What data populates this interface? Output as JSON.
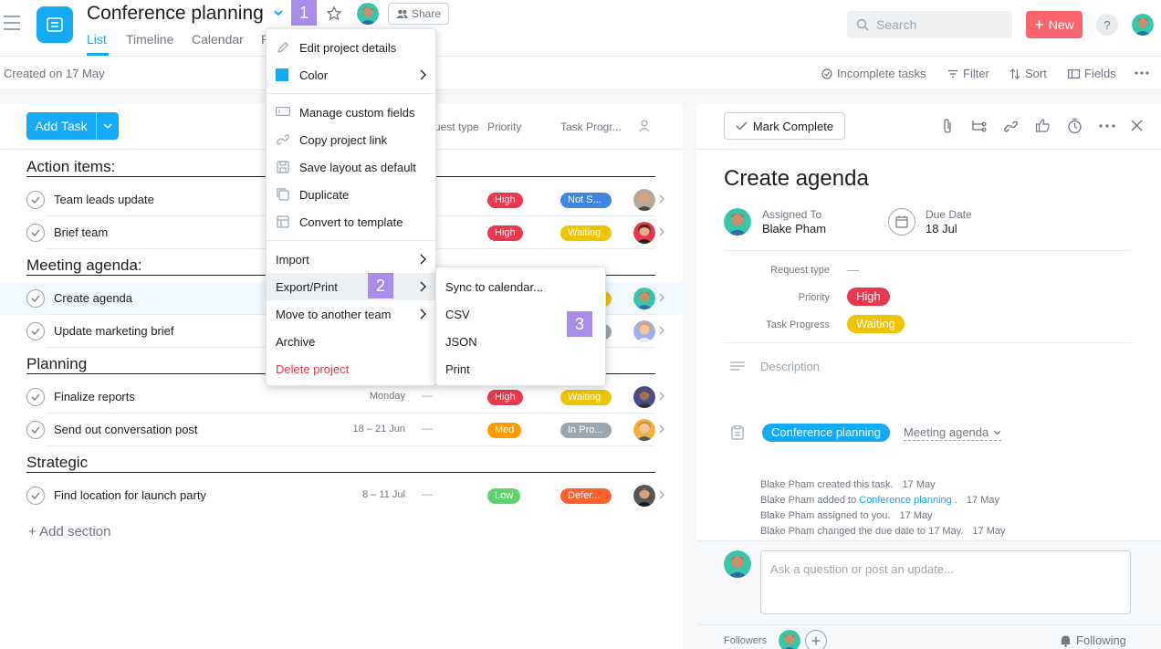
{
  "project": {
    "title": "Conference planning",
    "tabs": [
      "List",
      "Timeline",
      "Calendar",
      "P"
    ],
    "share_label": "Share",
    "created": "Created on 17 May"
  },
  "callouts": [
    "1",
    "2",
    "3"
  ],
  "topbar": {
    "search_placeholder": "Search",
    "new_label": "New",
    "help_label": "?"
  },
  "toolbar": {
    "incomplete": "Incomplete tasks",
    "filter": "Filter",
    "sort": "Sort",
    "fields": "Fields"
  },
  "list": {
    "add_task": "Add Task",
    "columns": {
      "request_type": "uest type",
      "priority": "Priority",
      "progress": "Task Progr..."
    },
    "add_section": "+ Add section",
    "sections": [
      {
        "title": "Action items:",
        "tasks": [
          {
            "name": "Team leads update",
            "due": "",
            "priority": "High",
            "progress": "Not S..."
          },
          {
            "name": "Brief team",
            "due": "",
            "priority": "High",
            "progress": "Waiting"
          }
        ]
      },
      {
        "title": "Meeting agenda:",
        "tasks": [
          {
            "name": "Create agenda",
            "due": "",
            "priority": "",
            "progress": ""
          },
          {
            "name": "Update marketing brief",
            "due": "",
            "priority": "",
            "progress": ""
          }
        ]
      },
      {
        "title": "Planning",
        "tasks": [
          {
            "name": "Finalize reports",
            "due": "Monday",
            "dash": "—",
            "priority": "High",
            "progress": "Waiting"
          },
          {
            "name": "Send out conversation post",
            "due": "18 – 21 Jun",
            "dash": "—",
            "priority": "Med",
            "progress": "In Pro..."
          }
        ]
      },
      {
        "title": "Strategic",
        "tasks": [
          {
            "name": "Find location for launch party",
            "due": "8 – 11 Jul",
            "dash": "—",
            "priority": "Low",
            "progress": "Defer..."
          }
        ]
      }
    ]
  },
  "project_menu": {
    "items": [
      "Edit project details",
      "Color",
      "Manage custom fields",
      "Copy project link",
      "Save layout as default",
      "Duplicate",
      "Convert to template",
      "Import",
      "Export/Print",
      "Move to another team",
      "Archive",
      "Delete project"
    ]
  },
  "export_menu": {
    "items": [
      "Sync to calendar...",
      "CSV",
      "JSON",
      "Print"
    ]
  },
  "detail": {
    "mark_complete": "Mark Complete",
    "title": "Create agenda",
    "assigned_label": "Assigned To",
    "assignee": "Blake Pham",
    "due_label": "Due Date",
    "due_value": "18 Jul",
    "request_type_label": "Request type",
    "request_type_value": "—",
    "priority_label": "Priority",
    "priority_value": "High",
    "progress_label": "Task Progress",
    "progress_value": "Waiting",
    "description_placeholder": "Description",
    "project_tag": "Conference planning",
    "section_tag": "Meeting agenda",
    "activity": [
      {
        "who": "Blake Pham",
        "text": " created this task.",
        "when": "17 May"
      },
      {
        "who": "Blake Pham",
        "text": " added to ",
        "link": "Conference planning",
        "after": " .",
        "when": "17 May"
      },
      {
        "who": "Blake Pham",
        "text": " assigned to you.",
        "when": "17 May"
      },
      {
        "who": "Blake Pham",
        "text": " changed the due date to 17 May.",
        "when": "17 May"
      }
    ],
    "comment_placeholder": "Ask a question or post an update...",
    "followers_label": "Followers",
    "following_label": "Following"
  },
  "colors": {
    "accent": "#14aaf5",
    "high": "#e8384f",
    "med": "#fd9a00",
    "low": "#62d26f",
    "waiting": "#eec300",
    "not_started": "#4186e0",
    "in_progress": "#9ca6af",
    "deferred": "#fd612c",
    "callout": "#a88ce8",
    "new_button": "#fc636b"
  }
}
